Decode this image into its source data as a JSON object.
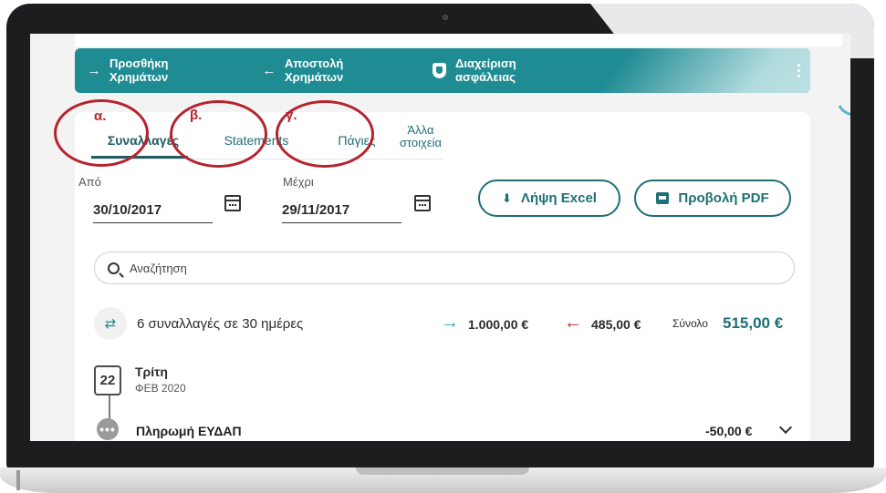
{
  "actions": {
    "add_money": "Προσθήκη\nΧρημάτων",
    "send_money": "Αποστολή\nΧρημάτων",
    "security": "Διαχείριση\nασφάλειας"
  },
  "tabs": {
    "transactions": "Συναλλαγές",
    "statements": "Statements",
    "fixed": "Πάγιες",
    "other": "Άλλα\nστοιχεία"
  },
  "annotations": {
    "a": "α.",
    "b": "β.",
    "c": "γ.",
    "color": "#b5242e"
  },
  "filters": {
    "from_label": "Από",
    "from_value": "30/10/2017",
    "to_label": "Μέχρι",
    "to_value": "29/11/2017"
  },
  "buttons": {
    "excel": "Λήψη Excel",
    "pdf": "Προβολή PDF"
  },
  "search": {
    "placeholder": "Αναζήτηση"
  },
  "summary": {
    "text": "6 συναλλαγές σε 30 ημέρες",
    "incoming": "1.000,00 €",
    "outgoing": "485,00 €",
    "total_label": "Σύνολο",
    "total_value": "515,00 €"
  },
  "day_group": {
    "day_number": "22",
    "weekday": "Τρίτη",
    "month_year": "ΦΕΒ 2020"
  },
  "transaction": {
    "name": "Πληρωμή ΕΥΔΑΠ",
    "amount": "-50,00 €"
  },
  "colors": {
    "brand": "#1f8b93",
    "brand_dark": "#1f5c63",
    "accent_red": "#b5242e"
  }
}
